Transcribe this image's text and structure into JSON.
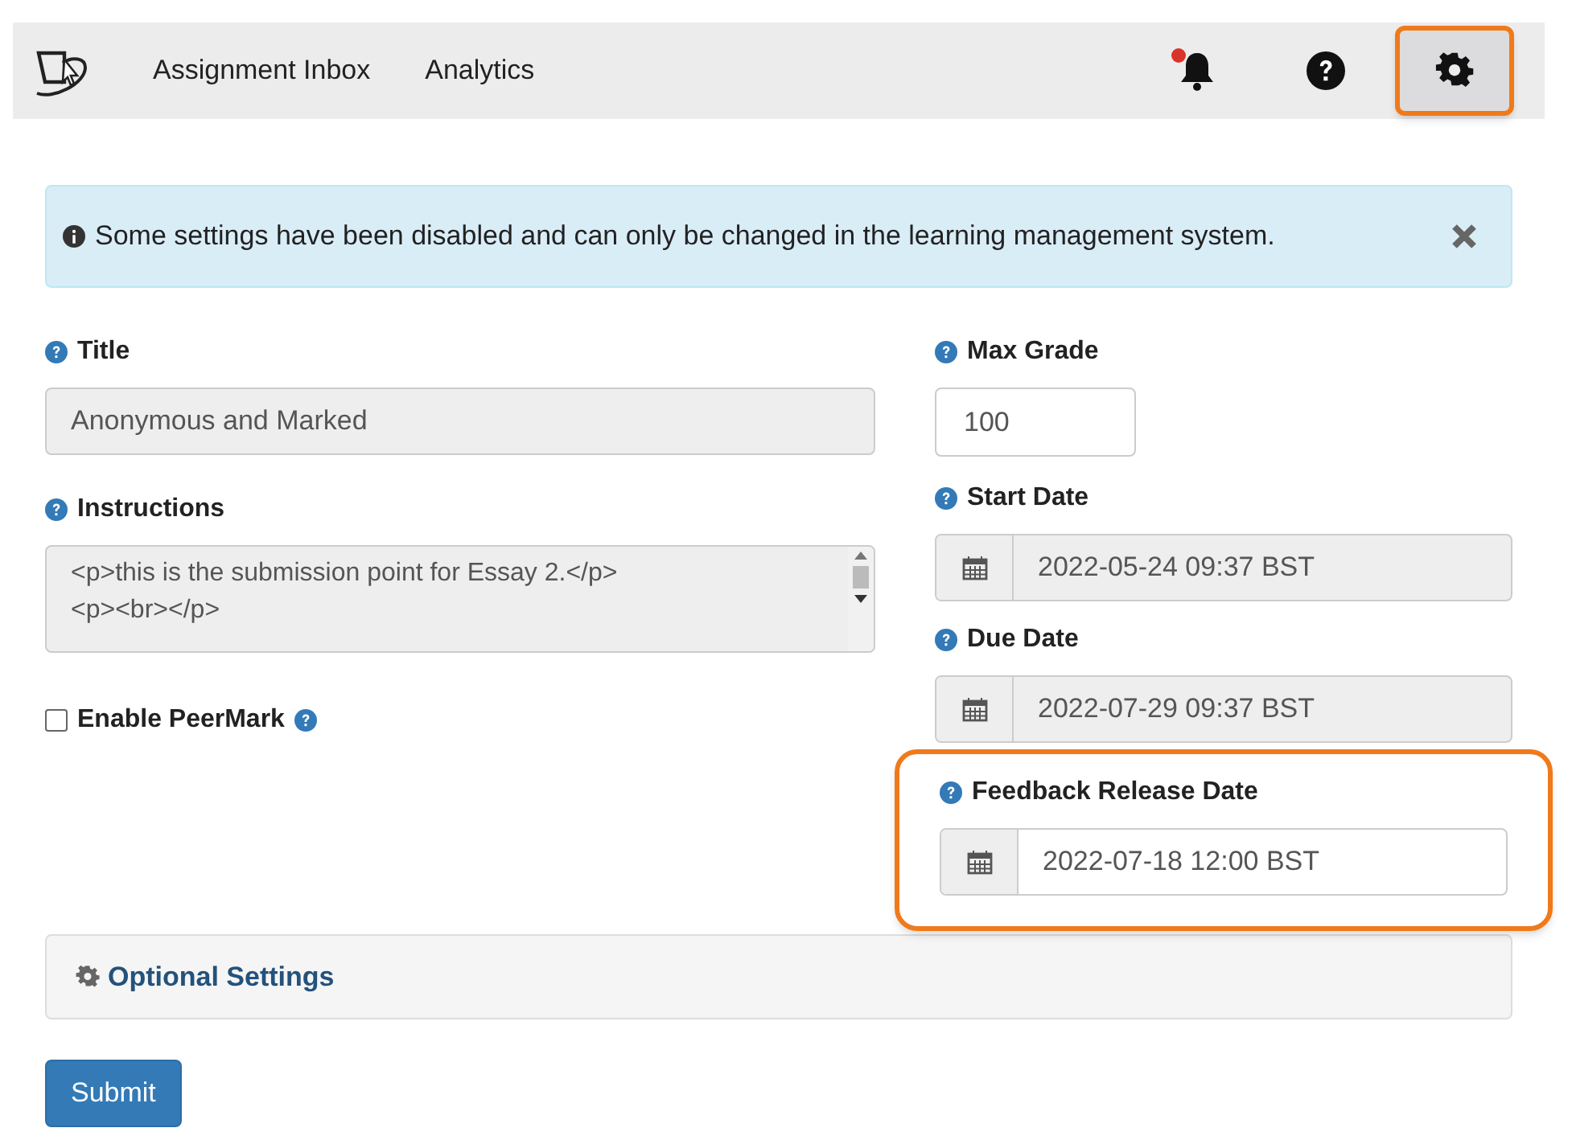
{
  "nav": {
    "links": [
      {
        "label": "Assignment Inbox"
      },
      {
        "label": "Analytics"
      }
    ],
    "icons": [
      {
        "kind": "bell",
        "badge": true,
        "highlighted": false
      },
      {
        "kind": "help",
        "badge": false,
        "highlighted": false
      },
      {
        "kind": "settings",
        "badge": false,
        "highlighted": true
      }
    ]
  },
  "alert": {
    "text": "Some settings have been disabled and can only be changed in the learning management system."
  },
  "title_field": {
    "label": "Title",
    "value": "Anonymous and Marked",
    "disabled": true
  },
  "instructions": {
    "label": "Instructions",
    "lines": [
      "<p>this is the submission point for Essay 2.</p>",
      "<p><br></p>"
    ],
    "disabled": true
  },
  "peermark": {
    "label": "Enable PeerMark",
    "checked": false
  },
  "max_grade": {
    "label": "Max Grade",
    "value": "100"
  },
  "dates": [
    {
      "label": "Start Date",
      "value": "2022-05-24 09:37 BST",
      "disabled": true,
      "highlighted": false
    },
    {
      "label": "Due Date",
      "value": "2022-07-29 09:37 BST",
      "disabled": true,
      "highlighted": false
    },
    {
      "label": "Feedback Release Date",
      "value": "2022-07-18 12:00 BST",
      "disabled": false,
      "highlighted": true
    }
  ],
  "optional_settings": {
    "label": "Optional Settings"
  },
  "submit": {
    "label": "Submit"
  }
}
